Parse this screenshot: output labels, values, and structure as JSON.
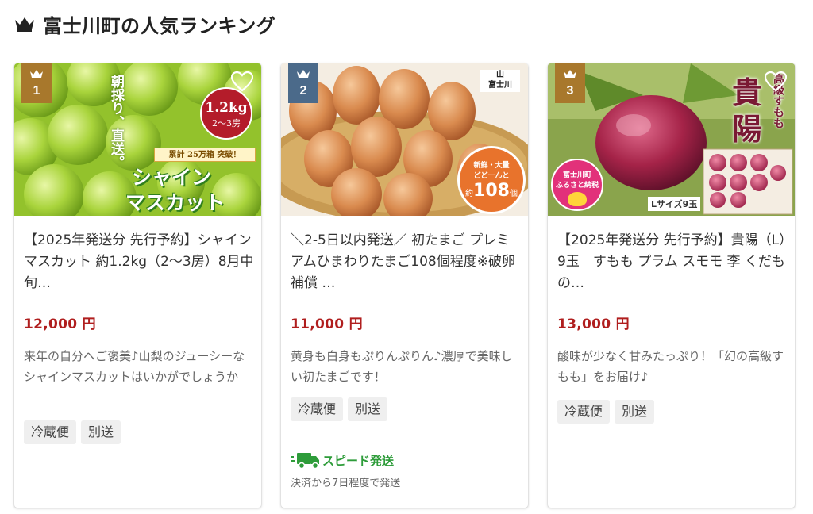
{
  "section": {
    "title": "富士川町の人気ランキング",
    "icon": "crown-icon"
  },
  "colors": {
    "accent_brown": "#a8782c",
    "accent_slate": "#4b6a8a",
    "price_red": "#b01e1e",
    "speed_green": "#2e9c3a",
    "tag_bg": "#efefef"
  },
  "cards": [
    {
      "rank": "1",
      "image_text": {
        "catch": "朝採り、直送。",
        "weight": "1.2kg",
        "bunches": "2〜3房",
        "ribbon": "累計 25万箱 突破！",
        "big_line1": "シャイン",
        "big_line2": "マスカット"
      },
      "name": "【2025年発送分 先行予約】シャインマスカット 約1.2kg（2〜3房）8月中旬…",
      "price": "12,000 円",
      "description": "来年の自分へご褒美♪山梨のジューシーなシャインマスカットはいかがでしょうか",
      "tags": [
        "冷蔵便",
        "別送"
      ]
    },
    {
      "rank": "2",
      "image_text": {
        "logo_top": "山",
        "logo_bottom": "富士川",
        "badge_line1": "新鮮・大量",
        "badge_line2": "どどーんと",
        "badge_prefix": "約",
        "badge_number": "108",
        "badge_unit": "個"
      },
      "name": "＼2-5日以内発送／ 初たまご プレミアムひまわりたまご108個程度※破卵補償 …",
      "price": "11,000 円",
      "description": "黄身も白身もぷりんぷりん♪濃厚で美味しい初たまごです！",
      "tags": [
        "冷蔵便",
        "別送"
      ],
      "speed_label": "スピード発送",
      "speed_note": "決済から7日程度で発送"
    },
    {
      "rank": "3",
      "image_text": {
        "kanji1": "貴",
        "kanji2": "陽",
        "vertical": "高級すもも",
        "stamp_line1": "富士川町",
        "stamp_line2": "ふるさと納税",
        "box_label": "Lサイズ9玉"
      },
      "name": "【2025年発送分 先行予約】貴陽（L）9玉　すもも プラム スモモ 李 くだもの…",
      "price": "13,000 円",
      "description": "酸味が少なく甘みたっぷり！「幻の高級すもも」をお届け♪",
      "tags": [
        "冷蔵便",
        "別送"
      ]
    }
  ]
}
